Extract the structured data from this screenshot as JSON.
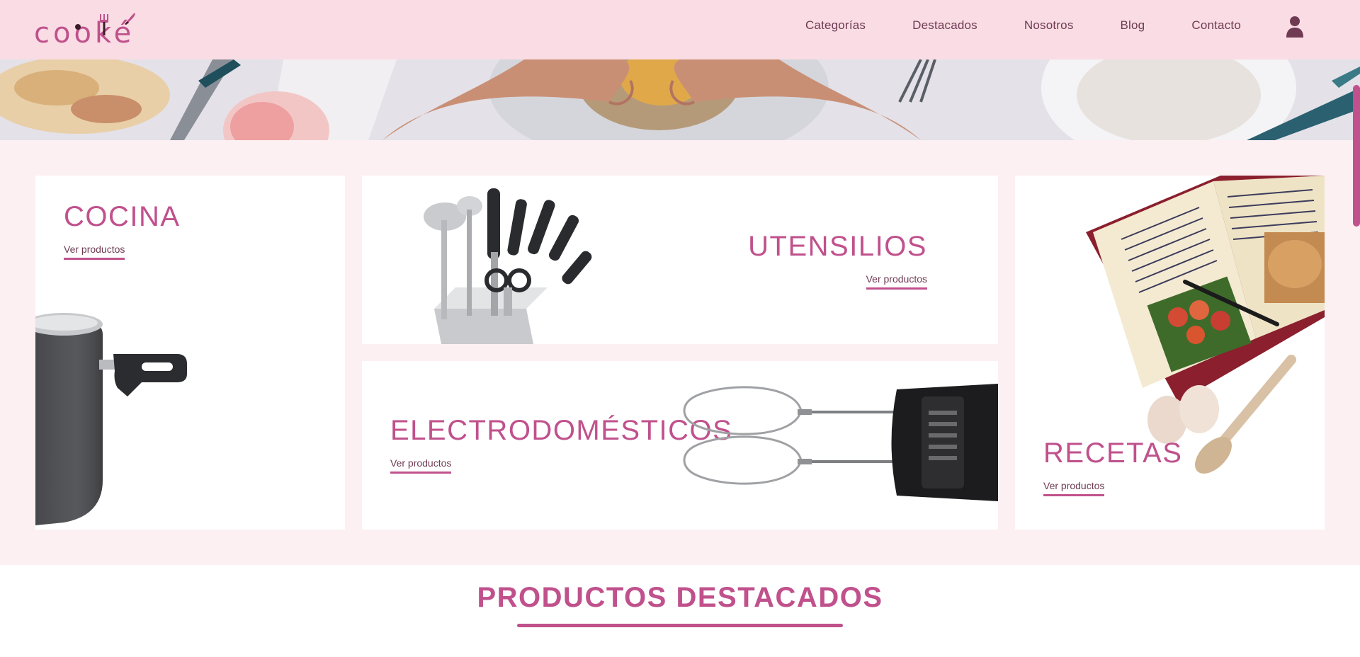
{
  "brand": {
    "logo_text": "cooké"
  },
  "nav": {
    "items": [
      {
        "label": "Categorías"
      },
      {
        "label": "Destacados"
      },
      {
        "label": "Nosotros"
      },
      {
        "label": "Blog"
      },
      {
        "label": "Contacto"
      }
    ],
    "user_icon": "user-icon"
  },
  "categories": {
    "cocina": {
      "title": "COCINA",
      "link": "Ver productos",
      "image": "pot-image"
    },
    "utensilios": {
      "title": "UTENSILIOS",
      "link": "Ver productos",
      "image": "knife-block-image"
    },
    "electro": {
      "title": "ELECTRODOMÉSTICOS",
      "link": "Ver productos",
      "image": "hand-mixer-image"
    },
    "recetas": {
      "title": "RECETAS",
      "link": "Ver productos",
      "image": "recipe-book-image"
    }
  },
  "featured": {
    "title": "PRODUCTOS DESTACADOS"
  },
  "colors": {
    "accent": "#c0518c",
    "nav_bg": "#f9dce4",
    "section_bg": "#fcf0f3",
    "text_dark": "#6e3b52"
  }
}
